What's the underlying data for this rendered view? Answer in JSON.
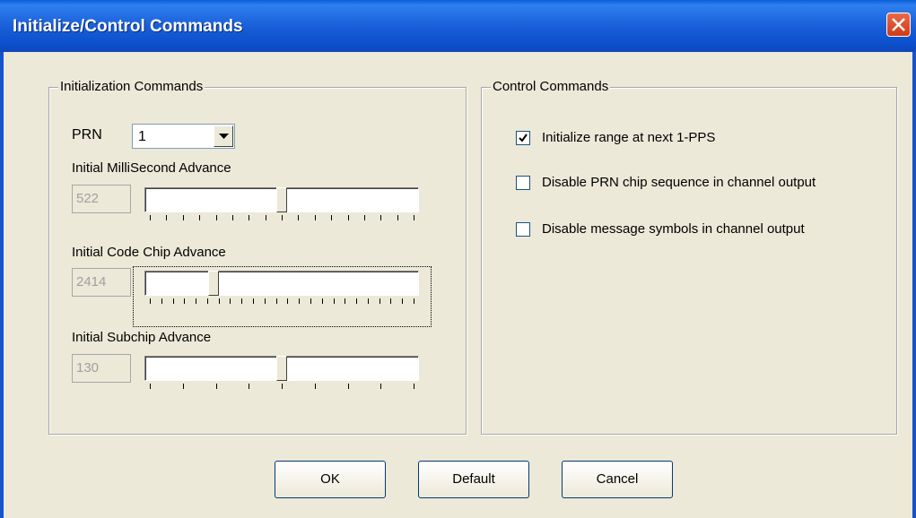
{
  "window": {
    "title": "Initialize/Control Commands"
  },
  "init_group": {
    "label": "Initialization Commands",
    "prn_label": "PRN",
    "prn_value": "1",
    "ms_label": "Initial MilliSecond Advance",
    "ms_value": "522",
    "ms_level": 0.5,
    "chip_label": "Initial Code Chip Advance",
    "chip_value": "2414",
    "chip_level": 0.24,
    "subchip_label": "Initial Subchip Advance",
    "subchip_value": "130",
    "subchip_level": 0.5
  },
  "control_group": {
    "label": "Control Commands",
    "options": [
      {
        "label": "Initialize range at next 1-PPS",
        "checked": true
      },
      {
        "label": "Disable PRN chip sequence in channel output",
        "checked": false
      },
      {
        "label": "Disable message symbols in channel output",
        "checked": false
      }
    ]
  },
  "buttons": {
    "ok": "OK",
    "default": "Default",
    "cancel": "Cancel"
  },
  "icons": {
    "close": "close-icon",
    "dropdown": "chevron-down-icon",
    "check": "check-icon"
  }
}
